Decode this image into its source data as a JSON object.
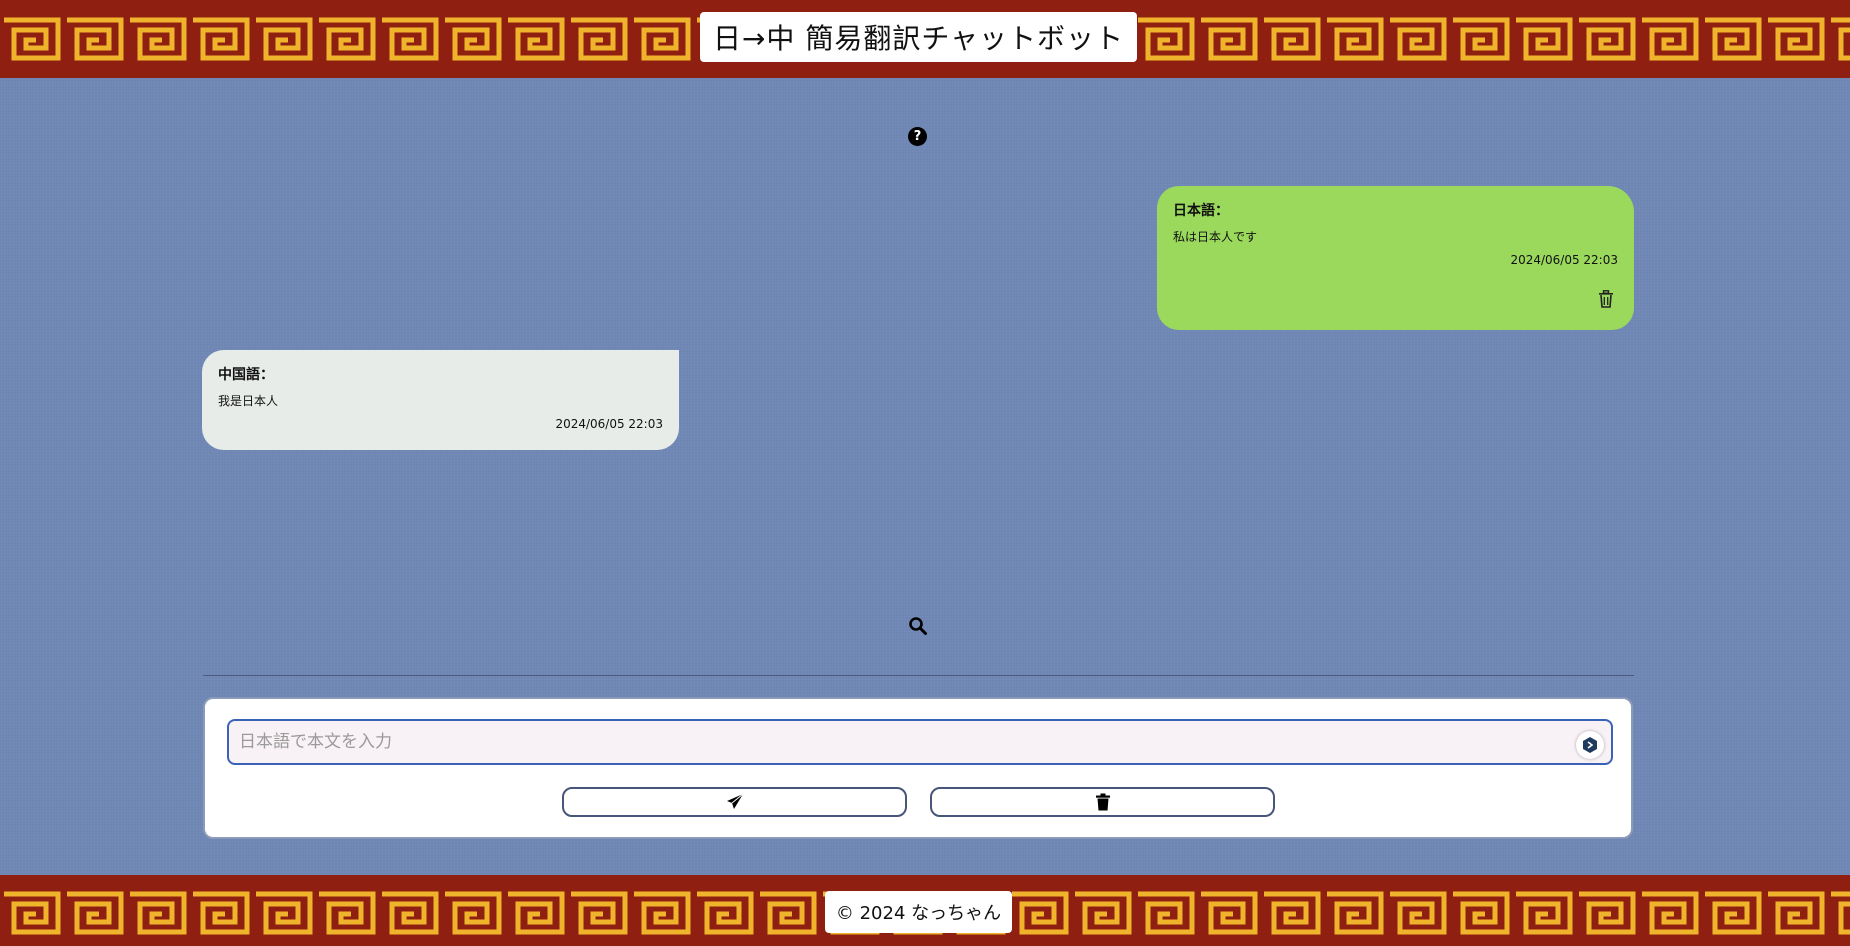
{
  "header": {
    "title": "日→中 簡易翻訳チャットボット"
  },
  "messages": [
    {
      "side": "right",
      "label": "日本語：",
      "text": "私は日本人です",
      "timestamp": "2024/06/05 22:03",
      "color": "#9bd95d"
    },
    {
      "side": "left",
      "label": "中国語：",
      "text": "我是日本人",
      "timestamp": "2024/06/05 22:03",
      "color": "#e8ece9"
    }
  ],
  "input": {
    "placeholder": "日本語で本文を入力",
    "value": ""
  },
  "icons": {
    "help": "question-circle-icon",
    "search": "magnifier-icon",
    "delete_message": "trash-outline-icon",
    "send": "paper-plane-icon",
    "clear": "trash-solid-icon",
    "assist": "extension-assist-icon"
  },
  "footer": {
    "text": "© 2024 なっちゃん"
  },
  "colors": {
    "background": "#6e86b4",
    "band": "#8f1f11",
    "meander": "#f0b42c",
    "input_border": "#3a63b7"
  }
}
